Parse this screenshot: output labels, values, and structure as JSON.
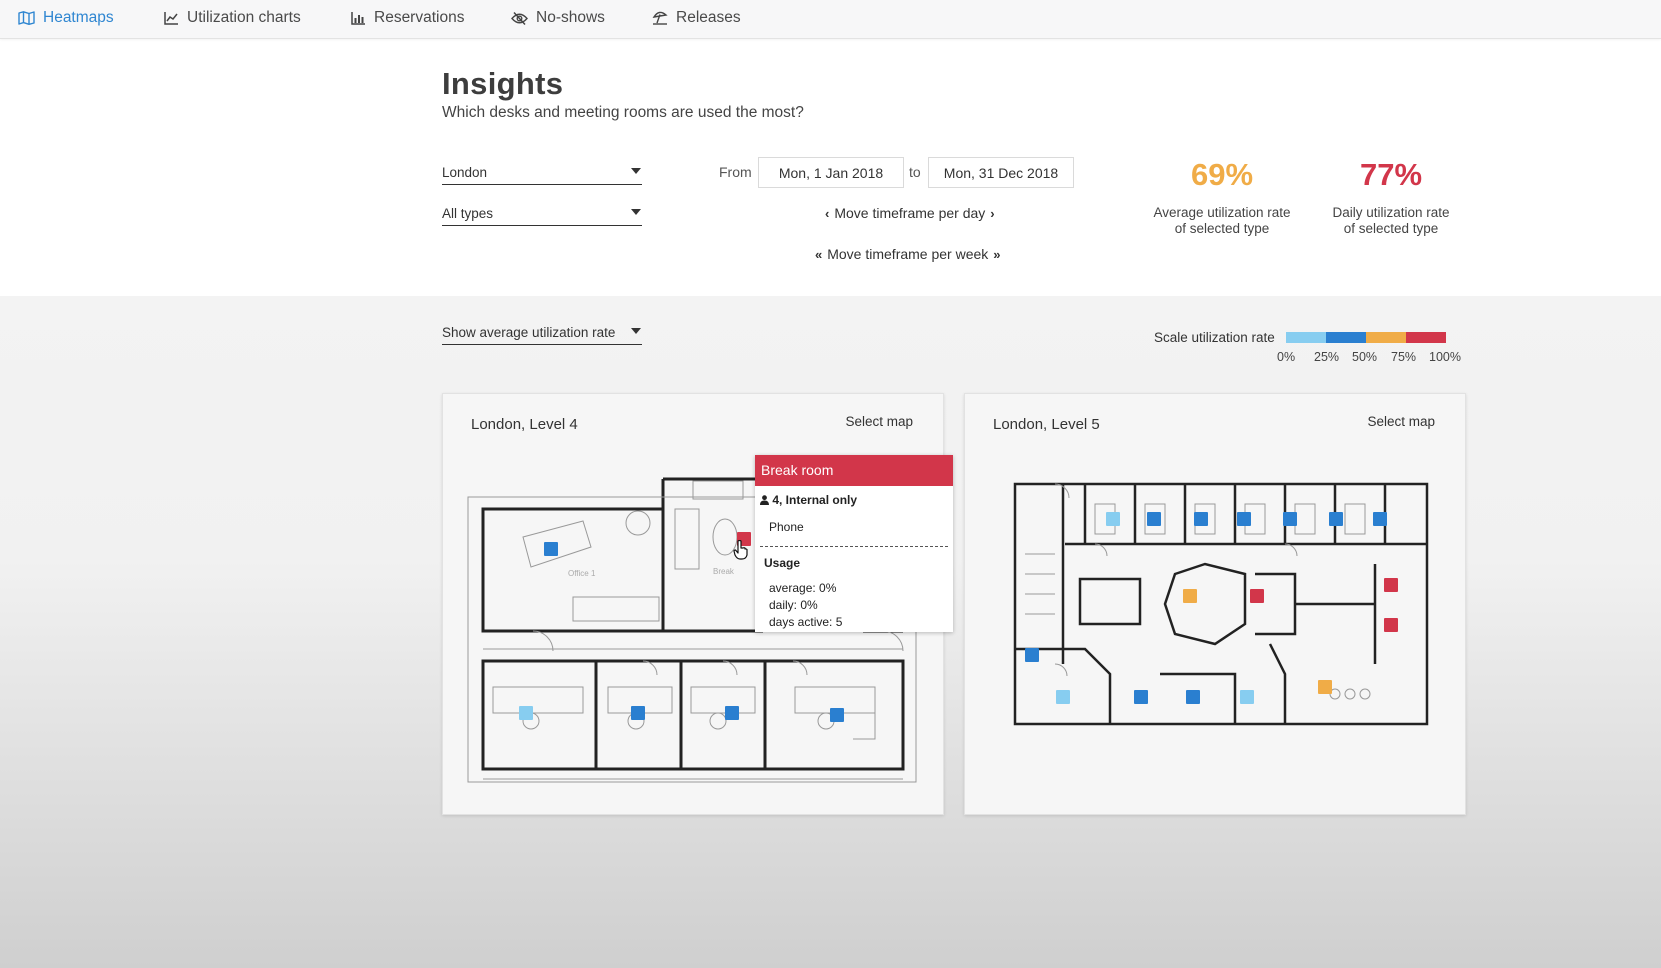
{
  "nav": {
    "tabs": [
      {
        "label": "Heatmaps",
        "icon": "map-icon",
        "active": true
      },
      {
        "label": "Utilization charts",
        "icon": "line-chart-icon",
        "active": false
      },
      {
        "label": "Reservations",
        "icon": "bar-chart-icon",
        "active": false
      },
      {
        "label": "No-shows",
        "icon": "eye-slash-icon",
        "active": false
      },
      {
        "label": "Releases",
        "icon": "umbrella-beach-icon",
        "active": false
      }
    ]
  },
  "header": {
    "title": "Insights",
    "subtitle": "Which desks and meeting rooms are used the most?"
  },
  "filters": {
    "location": "London",
    "type": "All types",
    "from_label": "From",
    "from_date": "Mon, 1 Jan 2018",
    "to_label": "to",
    "to_date": "Mon, 31 Dec 2018",
    "move_day": "Move timeframe per day",
    "move_week": "Move timeframe per week",
    "view_mode": "Show average utilization rate"
  },
  "stats": {
    "average_value": "69%",
    "average_label_1": "Average utilization rate",
    "average_label_2": "of selected type",
    "daily_value": "77%",
    "daily_label_1": "Daily utilization rate",
    "daily_label_2": "of selected type"
  },
  "scale": {
    "label": "Scale utilization rate",
    "ticks": [
      "0%",
      "25%",
      "50%",
      "75%",
      "100%"
    ],
    "colors": [
      "#87cdf0",
      "#2a7fd0",
      "#f0ac47",
      "#d2364a"
    ]
  },
  "maps": [
    {
      "title": "London, Level 4",
      "select_label": "Select map"
    },
    {
      "title": "London, Level 5",
      "select_label": "Select map"
    }
  ],
  "tooltip": {
    "title": "Break room",
    "capacity": "4, Internal only",
    "equipment": "Phone",
    "usage_label": "Usage",
    "average": "average: 0%",
    "daily": "daily: 0%",
    "days_active": "days active: 5"
  },
  "colors": {
    "accent": "#2f86d1",
    "average_stat": "#f0ac47",
    "daily_stat": "#d2364a",
    "tooltip_header": "#d2364a"
  }
}
